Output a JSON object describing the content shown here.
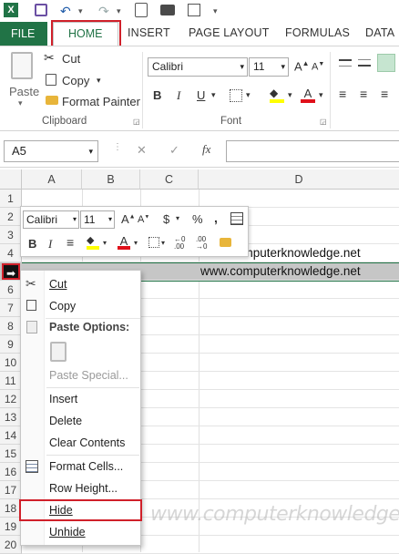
{
  "qat": {
    "excel_icon": "X",
    "save_icon": "floppy-icon",
    "undo_icon": "↶",
    "redo_icon": "↷",
    "preview_icon": "preview-icon",
    "more": "▾"
  },
  "tabs": {
    "file": "FILE",
    "home": "HOME",
    "insert": "INSERT",
    "page_layout": "PAGE LAYOUT",
    "formulas": "FORMULAS",
    "data": "DATA"
  },
  "clipboard": {
    "paste": "Paste",
    "cut": "Cut",
    "copy": "Copy",
    "format_painter": "Format Painter",
    "label": "Clipboard"
  },
  "font": {
    "name": "Calibri",
    "size": "11",
    "label": "Font",
    "bold": "B",
    "italic": "I",
    "underline": "U"
  },
  "formula_bar": {
    "name_box": "A5",
    "fx": "fx",
    "cancel": "✕",
    "enter": "✓"
  },
  "columns": [
    "A",
    "B",
    "C",
    "D"
  ],
  "rows": [
    "1",
    "2",
    "3",
    "4",
    "5",
    "6",
    "7",
    "8",
    "9",
    "10",
    "11",
    "12",
    "13",
    "14",
    "15",
    "16",
    "17",
    "18",
    "19",
    "20"
  ],
  "cells": {
    "D4": "www.computerknowledge.net",
    "D5": "www.computerknowledge.net"
  },
  "mini_toolbar": {
    "font": "Calibri",
    "size": "11",
    "grow": "A",
    "shrink": "A",
    "currency": "$",
    "percent": "%",
    "comma": ",",
    "bold": "B",
    "italic": "I",
    "dec_inc": ".00",
    "dec_dec": ".00"
  },
  "context_menu": {
    "cut": "Cut",
    "copy": "Copy",
    "paste_options": "Paste Options:",
    "paste_special": "Paste Special...",
    "insert": "Insert",
    "delete": "Delete",
    "clear_contents": "Clear Contents",
    "format_cells": "Format Cells...",
    "row_height": "Row Height...",
    "hide": "Hide",
    "unhide": "Unhide"
  },
  "watermark": "www.computerknowledge.net",
  "colors": {
    "excel_green": "#217346",
    "highlight_red": "#d0202a",
    "selected_row": "#c6c6c6"
  }
}
